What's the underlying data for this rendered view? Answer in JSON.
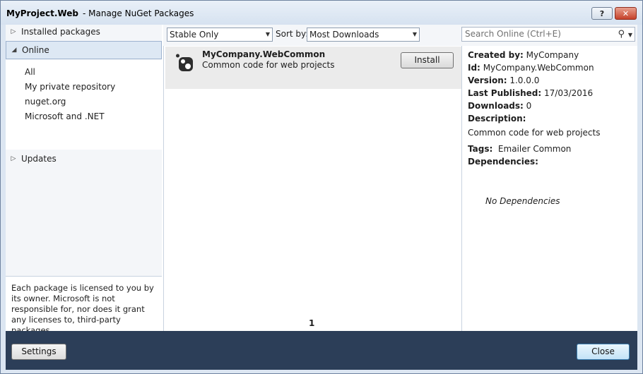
{
  "window": {
    "app_title": "MyProject.Web",
    "dialog_title": "- Manage NuGet Packages",
    "help_label": "?",
    "close_label": "✕"
  },
  "sidebar": {
    "installed_label": "Installed packages",
    "online_label": "Online",
    "sources": [
      "All",
      "My private repository",
      "nuget.org",
      "Microsoft and .NET"
    ],
    "updates_label": "Updates",
    "notice": "Each package is licensed to you by its owner. Microsoft is not responsible for, nor does it grant any licenses to, third-party packages."
  },
  "toolbar": {
    "release_filter": "Stable Only",
    "sort_label": "Sort by:",
    "sort_value": "Most Downloads",
    "search_placeholder": "Search Online (Ctrl+E)"
  },
  "packages": [
    {
      "name": "MyCompany.WebCommon",
      "description": "Common code for web projects",
      "action_label": "Install"
    }
  ],
  "pager": {
    "current_page": "1"
  },
  "details": {
    "created_by_label": "Created by:",
    "created_by": "MyCompany",
    "id_label": "Id:",
    "id": "MyCompany.WebCommon",
    "version_label": "Version:",
    "version": "1.0.0.0",
    "last_published_label": "Last Published:",
    "last_published": "17/03/2016",
    "downloads_label": "Downloads:",
    "downloads": "0",
    "description_label": "Description:",
    "description": "Common code for web projects",
    "tags_label": "Tags:",
    "tags": "Emailer Common",
    "dependencies_label": "Dependencies:",
    "no_dependencies": "No Dependencies"
  },
  "footer": {
    "settings_label": "Settings",
    "close_label": "Close"
  },
  "colors": {
    "footer_bg": "#2c3e58",
    "selected_category": "#dde8f4",
    "close_button_red": "#c5412a"
  }
}
